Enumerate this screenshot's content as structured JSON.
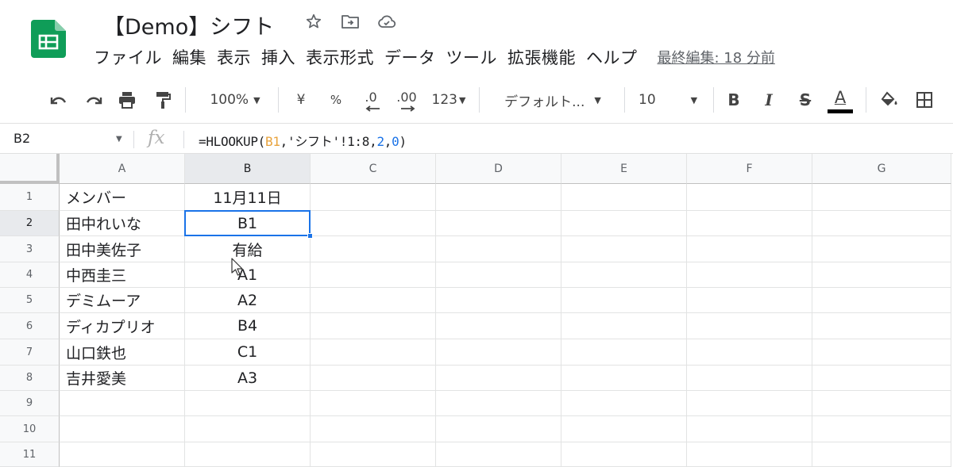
{
  "app": {
    "doc_title": "【Demo】シフト",
    "title_icons": [
      "star-icon",
      "move-to-folder-icon",
      "cloud-status-icon"
    ],
    "brand_color": "#0f9d58"
  },
  "menu": {
    "items": [
      "ファイル",
      "編集",
      "表示",
      "挿入",
      "表示形式",
      "データ",
      "ツール",
      "拡張機能",
      "ヘルプ"
    ],
    "last_edit": "最終編集: 18 分前"
  },
  "toolbar": {
    "zoom": "100%",
    "currency": "¥",
    "percent": "%",
    "decimal_decrease": ".0",
    "decimal_increase": ".00",
    "more_formats": "123",
    "font": "デフォルト...",
    "font_size": "10",
    "bold": "B",
    "italic": "I",
    "strikethrough": "S",
    "text_color": "A",
    "icons": [
      "undo-icon",
      "redo-icon",
      "print-icon",
      "paint-format-icon",
      "fill-color-icon",
      "borders-icon"
    ]
  },
  "formula_bar": {
    "name_box": "B2",
    "fx": "fx",
    "formula_prefix": "=HLOOKUP(",
    "formula_ref": "B1",
    "formula_mid": ",'シフト'!1:8,",
    "formula_arg1": "2",
    "formula_comma": ",",
    "formula_arg2": "0",
    "formula_suffix": ")"
  },
  "sheet": {
    "columns": [
      "A",
      "B",
      "C",
      "D",
      "E",
      "F",
      "G"
    ],
    "rows": [
      "1",
      "2",
      "3",
      "4",
      "5",
      "6",
      "7",
      "8",
      "9",
      "10",
      "11"
    ],
    "active_cell": "B2",
    "accent_color": "#1a73e8",
    "cells": {
      "A": [
        "メンバー",
        "田中れいな",
        "田中美佐子",
        "中西圭三",
        "デミムーア",
        "ディカプリオ",
        "山口鉄也",
        "吉井愛美",
        "",
        "",
        ""
      ],
      "B": [
        "11月11日",
        "B1",
        "有給",
        "A1",
        "A2",
        "B4",
        "C1",
        "A3",
        "",
        "",
        ""
      ]
    }
  }
}
